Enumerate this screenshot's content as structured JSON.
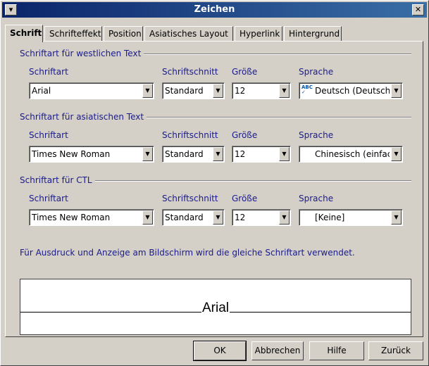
{
  "window": {
    "title": "Zeichen"
  },
  "tabs": [
    {
      "label": "Schrift"
    },
    {
      "label": "Schrifteffekt"
    },
    {
      "label": "Position"
    },
    {
      "label": "Asiatisches Layout"
    },
    {
      "label": "Hyperlink"
    },
    {
      "label": "Hintergrund"
    }
  ],
  "western": {
    "title": "Schriftart für westlichen Text",
    "font_label": "Schriftart",
    "style_label": "Schriftschnitt",
    "size_label": "Größe",
    "lang_label": "Sprache",
    "font": "Arial",
    "style": "Standard",
    "size": "12",
    "lang": "Deutsch (Deutschland)"
  },
  "asian": {
    "title": "Schriftart für asiatischen Text",
    "font_label": "Schriftart",
    "style_label": "Schriftschnitt",
    "size_label": "Größe",
    "lang_label": "Sprache",
    "font": "Times New Roman",
    "style": "Standard",
    "size": "12",
    "lang": "Chinesisch (einfach)"
  },
  "ctl": {
    "title": "Schriftart für CTL",
    "font_label": "Schriftart",
    "style_label": "Schriftschnitt",
    "size_label": "Größe",
    "lang_label": "Sprache",
    "font": "Times New Roman",
    "style": "Standard",
    "size": "12",
    "lang": "[Keine]"
  },
  "info": "Für Ausdruck und Anzeige am Bildschirm wird die gleiche Schriftart verwendet.",
  "preview": {
    "text": "Arial"
  },
  "buttons": {
    "ok": "OK",
    "cancel": "Abbrechen",
    "help": "Hilfe",
    "reset": "Zurück"
  },
  "icons": {
    "window_menu": "window-menu-icon",
    "close": "close-icon",
    "dropdown": "chevron-down-icon",
    "spellcheck": "spellcheck-icon"
  }
}
